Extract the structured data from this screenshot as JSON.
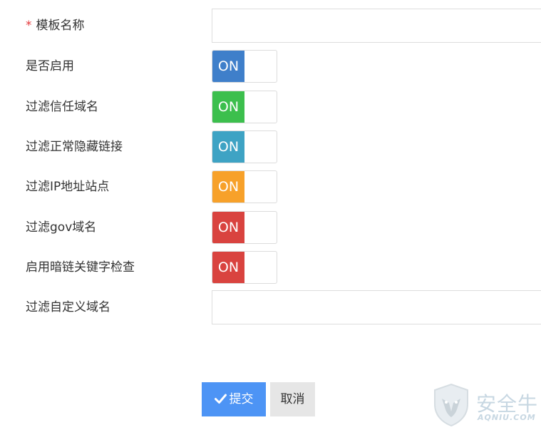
{
  "form": {
    "required_mark": "*",
    "template_name": {
      "label": "模板名称",
      "value": ""
    },
    "toggles": [
      {
        "label": "是否启用",
        "state": "ON",
        "color": "#3f7fca"
      },
      {
        "label": "过滤信任域名",
        "state": "ON",
        "color": "#3cbf4d"
      },
      {
        "label": "过滤正常隐藏链接",
        "state": "ON",
        "color": "#3ea3c4"
      },
      {
        "label": "过滤IP地址站点",
        "state": "ON",
        "color": "#f7a12a"
      },
      {
        "label": "过滤gov域名",
        "state": "ON",
        "color": "#d9433f"
      },
      {
        "label": "启用暗链关键字检查",
        "state": "ON",
        "color": "#d9433f"
      }
    ],
    "custom_domain": {
      "label": "过滤自定义域名",
      "value": ""
    }
  },
  "actions": {
    "submit_label": "提交",
    "cancel_label": "取消",
    "submit_color": "#4d94f5"
  },
  "watermark": {
    "text": "安全牛",
    "sub": "AQNIU.COM"
  }
}
